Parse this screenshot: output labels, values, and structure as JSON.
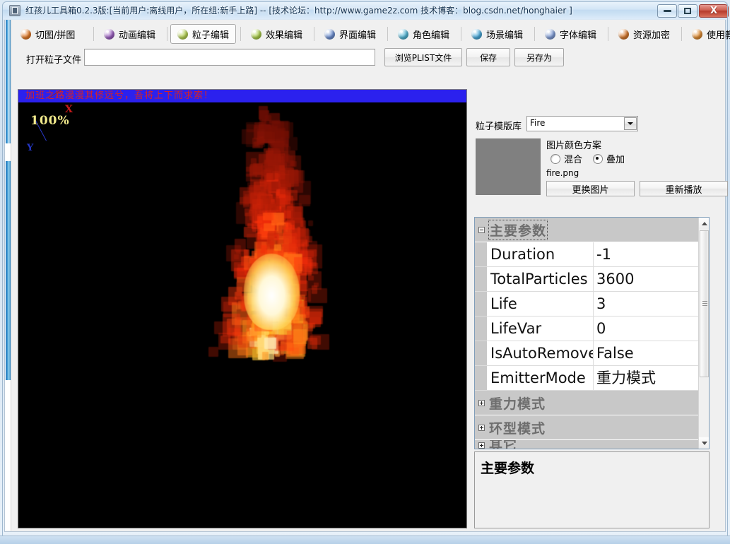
{
  "window": {
    "title": "红孩儿工具箱0.2.3版:[当前用户:离线用户，所在组:新手上路]  --  [技术论坛：http://www.game2z.com 技术博客：blog.csdn.net/honghaier ]",
    "icon": "app-icon",
    "controls": {
      "minimize": "minimize-icon",
      "maximize": "maximize-icon",
      "close": "X"
    }
  },
  "tabs": [
    {
      "label": "切图/拼图",
      "icon": "orange-ball-icon",
      "color": "#e07a2a",
      "active": false
    },
    {
      "label": "动画编辑",
      "icon": "purple-ball-icon",
      "color": "#9a5fbf",
      "active": false
    },
    {
      "label": "粒子编辑",
      "icon": "green-ball-icon",
      "color": "#b4cf54",
      "active": true
    },
    {
      "label": "效果编辑",
      "icon": "green-ball-icon",
      "color": "#a9cc4b",
      "active": false
    },
    {
      "label": "界面编辑",
      "icon": "blue-ball-icon",
      "color": "#6d8fd0",
      "active": false
    },
    {
      "label": "角色编辑",
      "icon": "cyan-ball-icon",
      "color": "#53b3d2",
      "active": false
    },
    {
      "label": "场景编辑",
      "icon": "cyan-ball-icon",
      "color": "#4aa8d8",
      "active": false
    },
    {
      "label": "字体编辑",
      "icon": "blue-ball-icon",
      "color": "#7f9bd4",
      "active": false
    },
    {
      "label": "资源加密",
      "icon": "orange-ball-icon",
      "color": "#d4782e",
      "active": false
    },
    {
      "label": "使用教程",
      "icon": "orange-ball-icon",
      "color": "#dd8b33",
      "active": false
    }
  ],
  "toolbar": {
    "open_label": "打开粒子文件",
    "path_value": "",
    "path_placeholder": "",
    "browse_label": "浏览PLIST文件",
    "save_label": "保存",
    "save_as_label": "另存为"
  },
  "preview": {
    "banner_text": "加班之路漫漫其修远兮，吾将上下而求索！",
    "banner_bg": "#2b21ee",
    "banner_fg": "#d2232a",
    "zoom_label": "100%",
    "axis_x_label": "X",
    "axis_y_label": "Y",
    "background": "#000000"
  },
  "template_library": {
    "label": "粒子模版库",
    "selected": "Fire",
    "options": [
      "Fire"
    ]
  },
  "image_panel": {
    "color_scheme_label": "图片颜色方案",
    "swatch_color": "#808080",
    "radios": [
      {
        "label": "混合",
        "selected": false
      },
      {
        "label": "叠加",
        "selected": true
      }
    ],
    "file_name": "fire.png",
    "change_image_label": "更换图片",
    "replay_label": "重新播放"
  },
  "property_grid": {
    "categories": [
      {
        "label": "主要参数",
        "expanded": true,
        "selected": true,
        "rows": [
          {
            "name": "Duration",
            "value": "-1"
          },
          {
            "name": "TotalParticles",
            "value": "3600"
          },
          {
            "name": "Life",
            "value": "3"
          },
          {
            "name": "LifeVar",
            "value": "0"
          },
          {
            "name": "IsAutoRemoveOnFinish",
            "value": "False"
          },
          {
            "name": "EmitterMode",
            "value": "重力模式"
          }
        ]
      },
      {
        "label": "重力模式",
        "expanded": false,
        "selected": false,
        "rows": []
      },
      {
        "label": "环型模式",
        "expanded": false,
        "selected": false,
        "rows": []
      },
      {
        "label": "其它",
        "expanded": false,
        "selected": false,
        "rows": []
      }
    ],
    "scrollbar": {
      "up": "scroll-up-icon",
      "down": "scroll-down-icon"
    }
  },
  "description": {
    "title": "主要参数",
    "body": ""
  }
}
